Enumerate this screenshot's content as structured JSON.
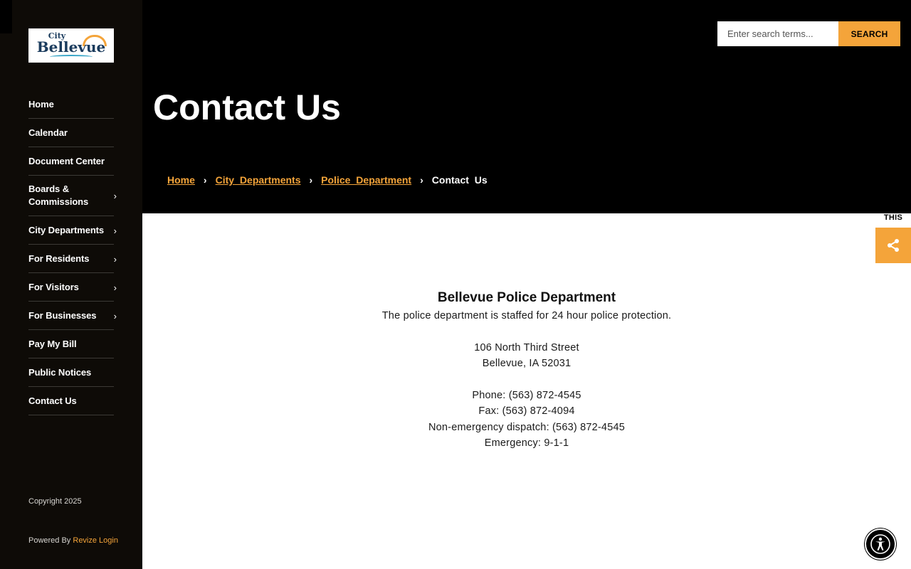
{
  "logo": {
    "city": "City",
    "name": "Bellevue"
  },
  "sidebar": {
    "items": [
      {
        "label": "Home",
        "has_children": false
      },
      {
        "label": "Calendar",
        "has_children": false
      },
      {
        "label": "Document Center",
        "has_children": false
      },
      {
        "label": "Boards & Commissions",
        "has_children": true
      },
      {
        "label": "City Departments",
        "has_children": true
      },
      {
        "label": "For Residents",
        "has_children": true
      },
      {
        "label": "For Visitors",
        "has_children": true
      },
      {
        "label": "For Businesses",
        "has_children": true
      },
      {
        "label": "Pay My Bill",
        "has_children": false
      },
      {
        "label": "Public Notices",
        "has_children": false
      },
      {
        "label": "Contact Us",
        "has_children": false
      }
    ],
    "copyright": "Copyright 2025",
    "powered_prefix": "Powered By ",
    "powered_link": "Revize Login"
  },
  "search": {
    "placeholder": "Enter search terms...",
    "button_label": "SEARCH"
  },
  "header": {
    "title": "Contact Us",
    "breadcrumb": {
      "links": [
        "Home",
        "City Departments",
        "Police Department"
      ],
      "separator": "›",
      "current": "Contact Us"
    }
  },
  "share": {
    "label": "THIS",
    "icon": "share-icon"
  },
  "content": {
    "heading": "Bellevue Police Department",
    "intro": "The police department is staffed for 24 hour police protection.",
    "address_line1": "106 North Third Street",
    "address_line2": "Bellevue, IA  52031",
    "phone": "Phone: (563) 872-4545",
    "fax": "Fax: (563) 872-4094",
    "dispatch": "Non-emergency dispatch: (563) 872-4545",
    "emergency": "Emergency: 9-1-1"
  },
  "colors": {
    "accent": "#f4a43a",
    "sidebar_bg": "#0e0b07",
    "hero_bg": "#000000"
  },
  "accessibility": {
    "icon": "accessibility-icon"
  }
}
